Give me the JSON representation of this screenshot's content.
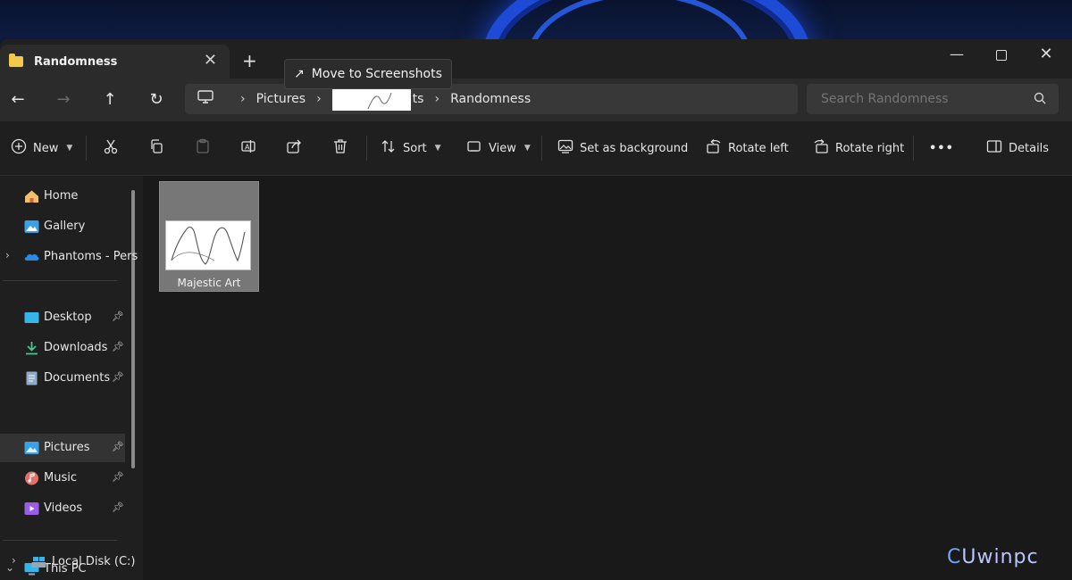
{
  "window": {
    "tab_title": "Randomness",
    "tab_close": "✕",
    "new_tab": "+",
    "minimize": "—",
    "close": "✕"
  },
  "tooltip": {
    "icon": "↗",
    "text": "Move to Screenshots"
  },
  "address": {
    "segments": [
      "Pictures",
      "ts",
      "Randomness"
    ],
    "search_placeholder": "Search Randomness"
  },
  "nav": {
    "back": "←",
    "forward": "→",
    "up": "↑",
    "refresh": "↻"
  },
  "toolbar": {
    "new_label": "New",
    "sort_label": "Sort",
    "view_label": "View",
    "set_background_label": "Set as background",
    "rotate_left_label": "Rotate left",
    "rotate_right_label": "Rotate right",
    "more_label": "•••",
    "details_label": "Details"
  },
  "sidebar": {
    "items": [
      {
        "label": "Home",
        "icon": "home-icon"
      },
      {
        "label": "Gallery",
        "icon": "gallery-icon"
      },
      {
        "label": "Phantoms - Pers",
        "icon": "onedrive-icon"
      },
      {
        "label": "Desktop",
        "icon": "desktop-icon"
      },
      {
        "label": "Downloads",
        "icon": "downloads-icon"
      },
      {
        "label": "Documents",
        "icon": "documents-icon"
      },
      {
        "label": "Pictures",
        "icon": "pictures-icon"
      },
      {
        "label": "Music",
        "icon": "music-icon"
      },
      {
        "label": "Videos",
        "icon": "videos-icon"
      },
      {
        "label": "This PC",
        "icon": "this-pc-icon"
      },
      {
        "label": "Local Disk (C:)",
        "icon": "drive-icon"
      }
    ],
    "selected": "Pictures"
  },
  "files": [
    {
      "name": "Majestic Art"
    }
  ],
  "watermark": {
    "mark": "C",
    "text": "Uwinpc"
  },
  "colors": {
    "accent": "#1d4bd6",
    "selected_bg": "#333333",
    "file_selected_bg": "#777777"
  }
}
